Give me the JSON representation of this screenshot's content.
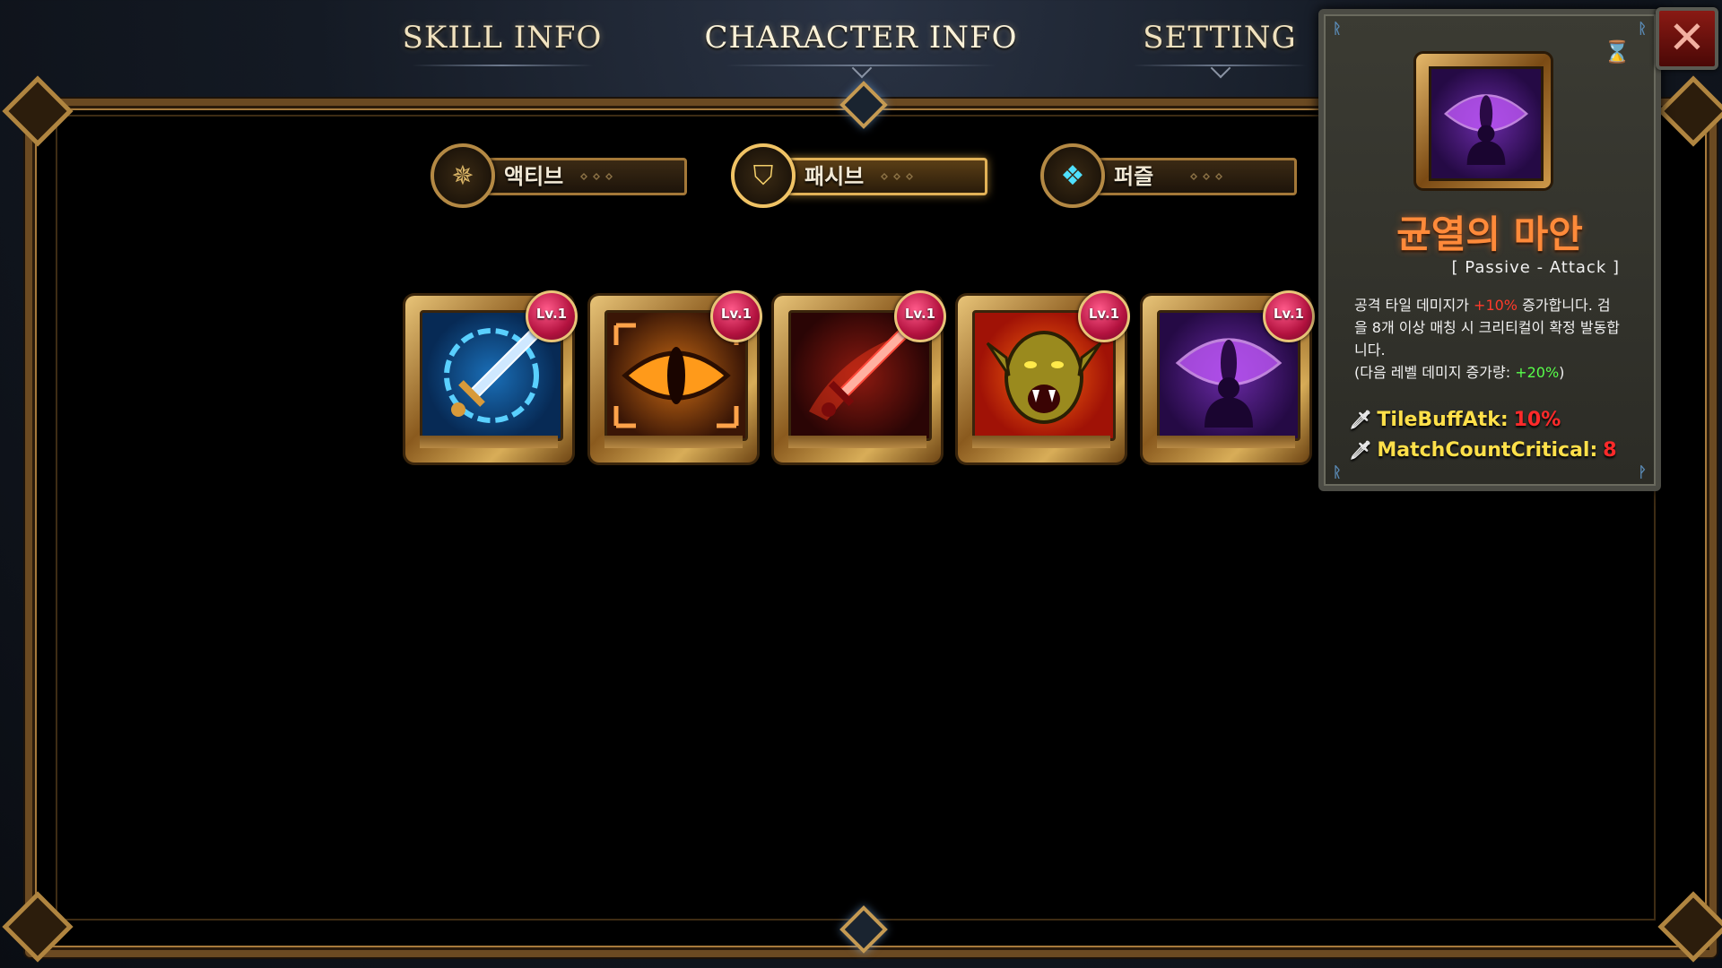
{
  "nav": {
    "tabs": [
      {
        "label": "SKILL INFO"
      },
      {
        "label": "CHARACTER INFO"
      },
      {
        "label": "SETTING"
      }
    ],
    "active_tab": "CHARACTER INFO"
  },
  "subtabs": [
    {
      "label": "액티브",
      "icon": "compass-icon"
    },
    {
      "label": "패시브",
      "icon": "shield-icon",
      "active": true
    },
    {
      "label": "퍼즐",
      "icon": "puzzle-knot-icon"
    }
  ],
  "skills": [
    {
      "level": "Lv.1",
      "icon": "blue-sword-icon"
    },
    {
      "level": "Lv.1",
      "icon": "dragon-eye-icon"
    },
    {
      "level": "Lv.1",
      "icon": "bloody-sword-icon"
    },
    {
      "level": "Lv.1",
      "icon": "orc-rage-icon"
    },
    {
      "level": "Lv.1",
      "icon": "purple-eye-icon"
    }
  ],
  "tooltip": {
    "icon": "purple-eye-icon",
    "title": "균열의 마안",
    "subtitle": "[ Passive - Attack ]",
    "desc_prefix": "공격 타일 데미지가",
    "desc_bonus": "+10%",
    "desc_mid": "증가합니다. 검을 8개 이상 매칭 시 크리티컬이 확정 발동합니다.",
    "desc_next_prefix": "(다음 레벨 데미지 증가량:",
    "desc_next_bonus": "+20%",
    "desc_next_suffix": ")",
    "stats": [
      {
        "name": "TileBuffAtk:",
        "value": "10%"
      },
      {
        "name": "MatchCountCritical:",
        "value": "8"
      }
    ]
  },
  "colors": {
    "gold": "#e8c478",
    "title_orange": "#ff8a3a",
    "stat_yellow": "#ffe04a",
    "stat_red": "#ff2a2a",
    "bonus_green": "#58ff4a"
  }
}
